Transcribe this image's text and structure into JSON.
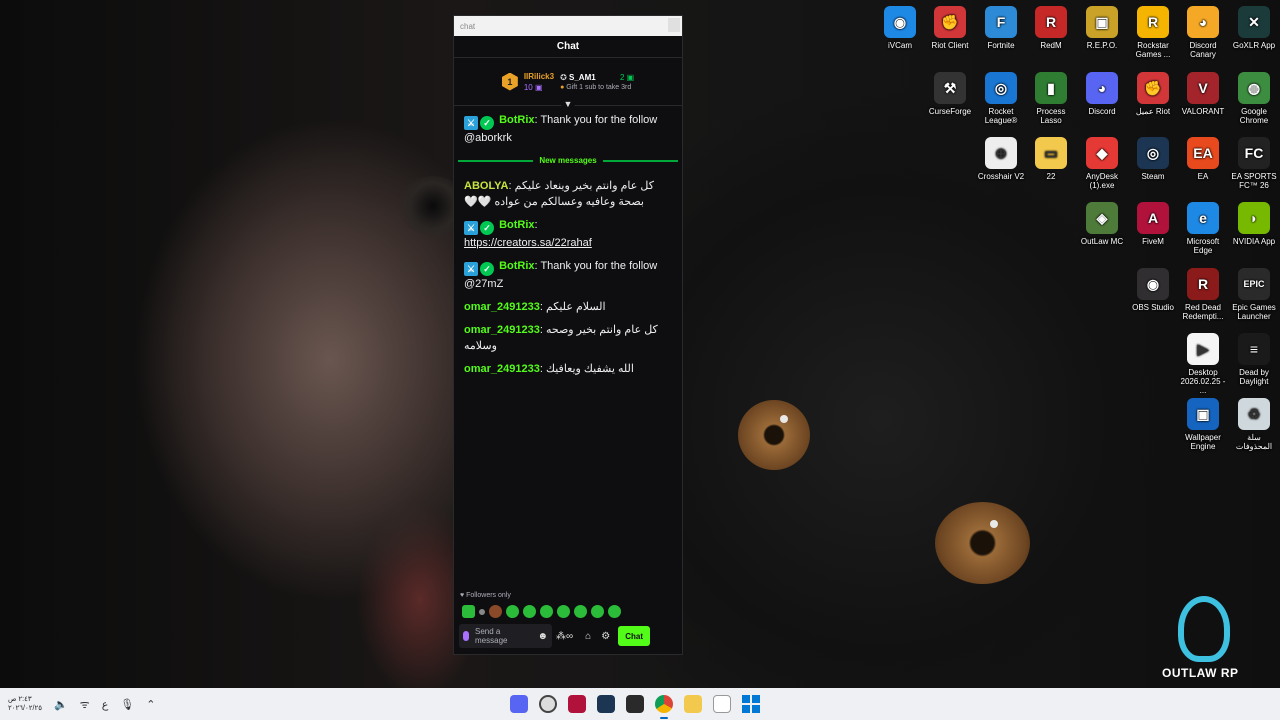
{
  "chat": {
    "window_title": "chat",
    "header": "Chat",
    "leaderboard": {
      "rank": "1",
      "first_name": "IIRilick3",
      "first_count": "10",
      "second_name": "S_AM1",
      "second_count": "2",
      "gift_hint": "Gift 1 sub to take 3rd"
    },
    "messages": [
      {
        "user": "BotRix",
        "text": "Thank you for the follow @aborkrk"
      },
      {
        "user": "ABOLYA",
        "text": "كل عام وانتم بخير وينعاد عليكم بصحة وعافيه وعسالكم من عواده 🤍🤍"
      },
      {
        "user": "BotRix",
        "text": "https://creators.sa/22rahaf"
      },
      {
        "user": "BotRix",
        "text": "Thank you for the follow @27mZ"
      },
      {
        "user": "omar_2491233",
        "text": "السلام عليكم"
      },
      {
        "user": "omar_2491233",
        "text": "كل عام وانتم بخير وصحه وسلامه"
      },
      {
        "user": "omar_2491233",
        "text": "الله يشفيك ويعافيك"
      }
    ],
    "new_messages_label": "New messages",
    "followers_only": "Followers only",
    "input_placeholder": "Send a message",
    "chat_button": "Chat"
  },
  "desktop_icons": [
    {
      "label": "iVCam",
      "color": "#1e88e5",
      "glyph": "◉"
    },
    {
      "label": "Riot Client",
      "color": "#d13639",
      "glyph": "✊"
    },
    {
      "label": "Fortnite",
      "color": "#2c8ad6",
      "glyph": "F"
    },
    {
      "label": "RedM",
      "color": "#c62828",
      "glyph": "R"
    },
    {
      "label": "R.E.P.O.",
      "color": "#c9a227",
      "glyph": "▣"
    },
    {
      "label": "Rockstar Games ...",
      "color": "#f4b400",
      "glyph": "R"
    },
    {
      "label": "Discord Canary",
      "color": "#f4a825",
      "glyph": "◕"
    },
    {
      "label": "GoXLR App",
      "color": "#1b3a3a",
      "glyph": "✕"
    },
    {
      "label": "CurseForge",
      "color": "#333333",
      "glyph": "⚒"
    },
    {
      "label": "Rocket League®",
      "color": "#1976d2",
      "glyph": "◎"
    },
    {
      "label": "Process Lasso",
      "color": "#2e7d32",
      "glyph": "▮"
    },
    {
      "label": "Discord",
      "color": "#5865f2",
      "glyph": "◕"
    },
    {
      "label": "عميل Riot",
      "color": "#d13639",
      "glyph": "✊"
    },
    {
      "label": "VALORANT",
      "color": "#a3242a",
      "glyph": "V"
    },
    {
      "label": "Google Chrome",
      "color": "#3c8d40",
      "glyph": "◍"
    },
    {
      "label": "Crosshair V2",
      "color": "#eeeeee",
      "glyph": "⊕"
    },
    {
      "label": "22",
      "color": "#f2c94c",
      "glyph": "▭"
    },
    {
      "label": "AnyDesk (1).exe",
      "color": "#e53935",
      "glyph": "◆"
    },
    {
      "label": "Steam",
      "color": "#1b3553",
      "glyph": "◎"
    },
    {
      "label": "EA",
      "color": "#e8491d",
      "glyph": "EA"
    },
    {
      "label": "EA SPORTS FC™ 26",
      "color": "#222222",
      "glyph": "FC"
    },
    {
      "label": "OutLaw MC",
      "color": "#4e7a3a",
      "glyph": "◈"
    },
    {
      "label": "FiveM",
      "color": "#b0123b",
      "glyph": "A"
    },
    {
      "label": "Microsoft Edge",
      "color": "#1e88e5",
      "glyph": "e"
    },
    {
      "label": "NVIDIA App",
      "color": "#76b900",
      "glyph": "◗"
    },
    {
      "label": "OBS Studio",
      "color": "#302e31",
      "glyph": "◉"
    },
    {
      "label": "Red Dead Redempti...",
      "color": "#8b1a1a",
      "glyph": "R"
    },
    {
      "label": "Epic Games Launcher",
      "color": "#2a2a2a",
      "glyph": "EPIC"
    },
    {
      "label": "Desktop 2026.02.25 - ...",
      "color": "#f5f5f5",
      "glyph": "▶"
    },
    {
      "label": "Dead by Daylight",
      "color": "#1a1a1a",
      "glyph": "≡"
    },
    {
      "label": "Wallpaper Engine",
      "color": "#1565c0",
      "glyph": "▣"
    },
    {
      "label": "سلة المحذوفات",
      "color": "#cfd8dc",
      "glyph": "♻"
    }
  ],
  "logo": {
    "text": "OUTLAW RP"
  },
  "taskbar": {
    "time": "٢:٤٣ ص",
    "date": "٢٠٢٦/٠٢/٢٥",
    "lang": "ع"
  }
}
